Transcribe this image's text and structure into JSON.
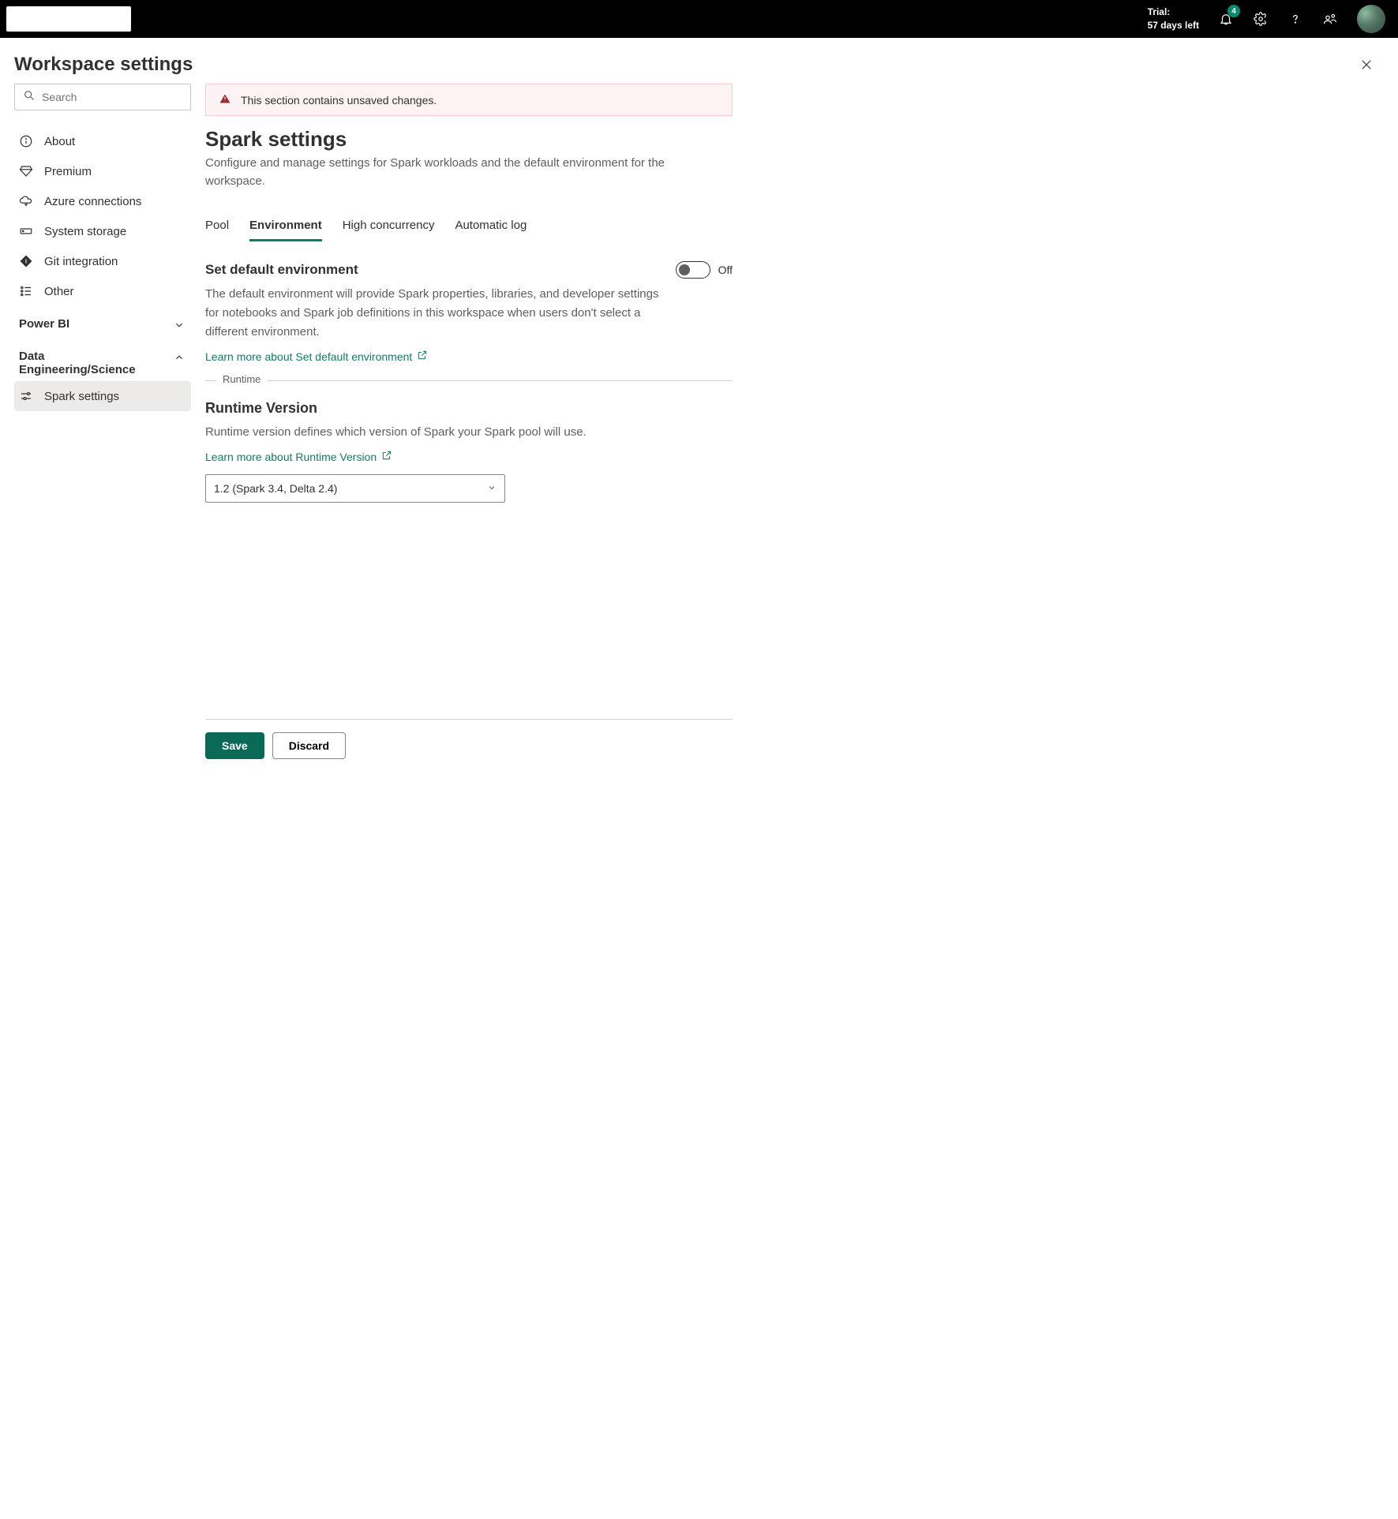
{
  "topbar": {
    "trial_label": "Trial:",
    "trial_days": "57 days left",
    "notification_count": "4"
  },
  "page": {
    "title": "Workspace settings"
  },
  "search": {
    "placeholder": "Search"
  },
  "nav": {
    "items": [
      {
        "label": "About"
      },
      {
        "label": "Premium"
      },
      {
        "label": "Azure connections"
      },
      {
        "label": "System storage"
      },
      {
        "label": "Git integration"
      },
      {
        "label": "Other"
      }
    ],
    "sections": {
      "powerbi": {
        "label": "Power BI",
        "expanded": false
      },
      "datasci": {
        "label": "Data Engineering/Science",
        "expanded": true
      }
    },
    "sub": {
      "spark": "Spark settings"
    }
  },
  "banner": {
    "text": "This section contains unsaved changes."
  },
  "spark": {
    "title": "Spark settings",
    "desc": "Configure and manage settings for Spark workloads and the default environment for the workspace.",
    "tabs": [
      {
        "label": "Pool",
        "active": false
      },
      {
        "label": "Environment",
        "active": true
      },
      {
        "label": "High concurrency",
        "active": false
      },
      {
        "label": "Automatic log",
        "active": false
      }
    ],
    "env": {
      "title": "Set default environment",
      "toggle_state": "Off",
      "desc": "The default environment will provide Spark properties, libraries, and developer settings for notebooks and Spark job definitions in this workspace when users don't select a different environment.",
      "link": "Learn more about Set default environment"
    },
    "runtime": {
      "legend": "Runtime",
      "title": "Runtime Version",
      "desc": "Runtime version defines which version of Spark your Spark pool will use.",
      "link": "Learn more about Runtime Version",
      "selected": "1.2 (Spark 3.4, Delta 2.4)"
    }
  },
  "footer": {
    "save": "Save",
    "discard": "Discard"
  }
}
